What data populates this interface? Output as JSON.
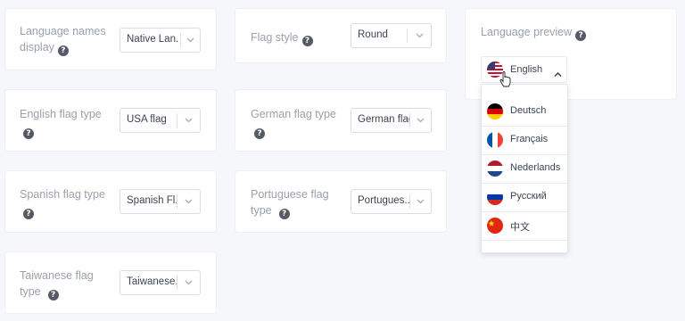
{
  "settings": {
    "language_names_display": {
      "label": "Language names display",
      "value": "Native Lan..."
    },
    "flag_style": {
      "label": "Flag style",
      "value": "Round"
    },
    "english_flag": {
      "label": "English flag type",
      "value": "USA flag"
    },
    "german_flag": {
      "label": "German flag type",
      "value": "German flag"
    },
    "spanish_flag": {
      "label": "Spanish flag type",
      "value": "Spanish Fl..."
    },
    "portuguese_flag": {
      "label_line1": "Portuguese flag",
      "label_line2": "type",
      "value": "Portugues..."
    },
    "taiwanese_flag": {
      "label_line1": "Taiwanese flag",
      "label_line2": "type",
      "value": "Taiwanese..."
    }
  },
  "preview": {
    "title": "Language preview",
    "current": "English",
    "languages": [
      "Deutsch",
      "Français",
      "Nederlands",
      "Русский",
      "中文"
    ]
  },
  "help_glyph": "?",
  "colors": {
    "background": "#f6f7fb",
    "card": "#ffffff",
    "help_icon": "#555b66",
    "text_value": "#3c4350",
    "text_label": "#9aa0ab"
  },
  "icons": [
    "help-icon",
    "chevron-down-icon",
    "chevron-up-icon",
    "cursor-hand-icon",
    "flag-us",
    "flag-de",
    "flag-fr",
    "flag-nl",
    "flag-ru",
    "flag-cn"
  ]
}
